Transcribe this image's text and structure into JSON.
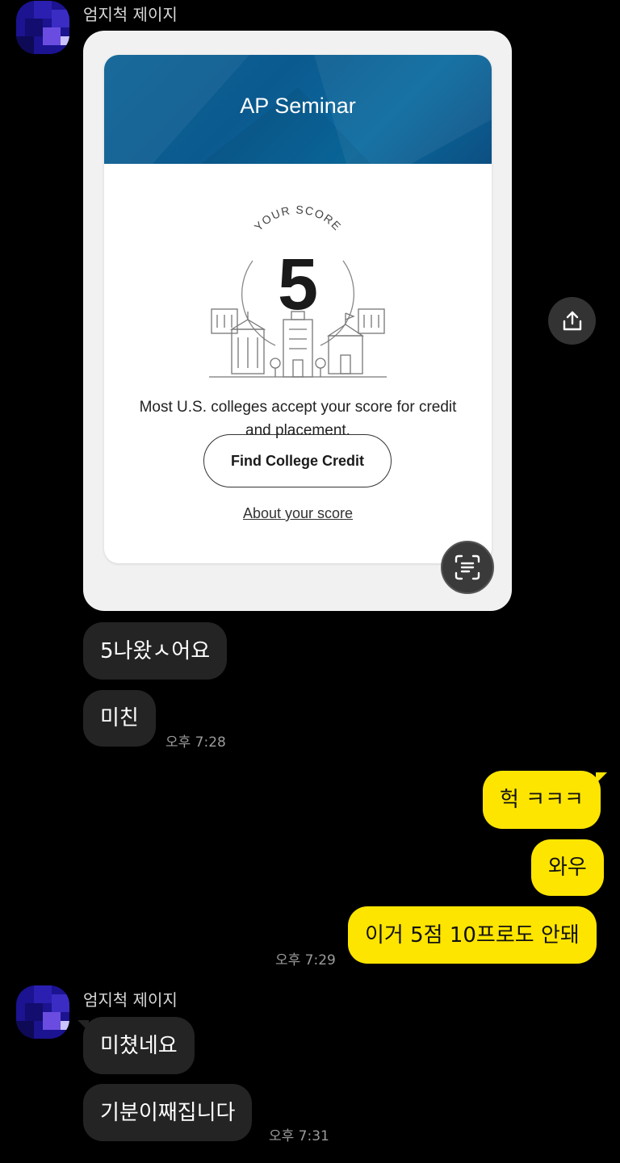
{
  "messages": {
    "group1": {
      "sender": "엄지척 제이지",
      "card": {
        "title": "AP Seminar",
        "score_label": "YOUR SCORE",
        "score": "5",
        "description": "Most U.S. colleges accept your score for credit and placement.",
        "button": "Find College Credit",
        "link": "About your score"
      },
      "bubble1": "5나왔ㅅ어요",
      "bubble2": "미친",
      "time": "오후 7:28"
    },
    "outgoing": {
      "bubble1": "헉 ㅋㅋㅋ",
      "bubble2": "와우",
      "bubble3": "이거 5점 10프로도 안돼",
      "time": "오후 7:29"
    },
    "group2": {
      "sender": "엄지척 제이지",
      "bubble1": "미쳤네요",
      "bubble2": "기분이째집니다",
      "time": "오후 7:31"
    }
  },
  "colors": {
    "background": "#000000",
    "incoming_bubble": "#242424",
    "outgoing_bubble": "#fee500",
    "card_header": "#0d6296"
  },
  "icons": {
    "share": "share-icon",
    "scan": "text-scan-icon"
  }
}
